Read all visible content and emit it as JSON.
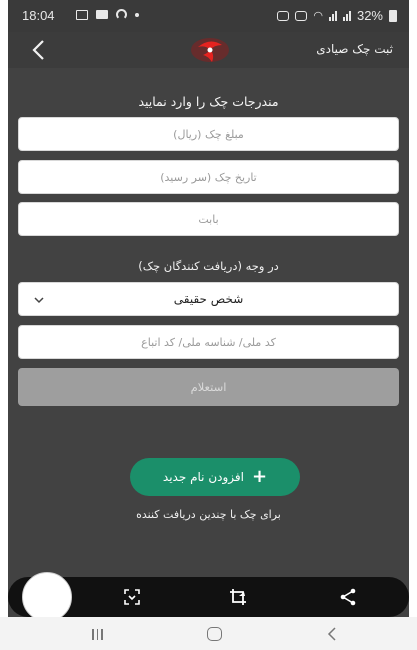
{
  "status_bar": {
    "time": "18:04",
    "battery": "32%"
  },
  "app_bar": {
    "title": "ثبت چک صیادی",
    "back_icon": "chevron-left-icon",
    "logo_icon": "bank-logo-icon"
  },
  "form": {
    "header": "مندرجات چک را وارد نمایید",
    "amount_placeholder": "مبلغ چک (ریال)",
    "date_placeholder": "تاریخ چک (سر رسید)",
    "reason_placeholder": "بابت",
    "recipients_label": "در وجه (دریافت کنندگان چک)",
    "person_type": {
      "selected": "شخص حقیقی"
    },
    "national_id_placeholder": "کد ملی/ شناسه ملی/ کد اتباع",
    "inquiry_button": "استعلام"
  },
  "add_recipient": {
    "button_label": "افزودن نام جدید",
    "helper_text": "برای چک با چندین دریافت کننده"
  },
  "colors": {
    "accent_green": "#1b8f6a",
    "background": "#424242"
  },
  "toolbar": {
    "icons": [
      "capture-circle-icon",
      "scan-icon",
      "crop-rotate-icon",
      "share-icon"
    ]
  },
  "nav_bar": {
    "icons": [
      "recent-apps-icon",
      "home-icon",
      "back-icon"
    ]
  }
}
